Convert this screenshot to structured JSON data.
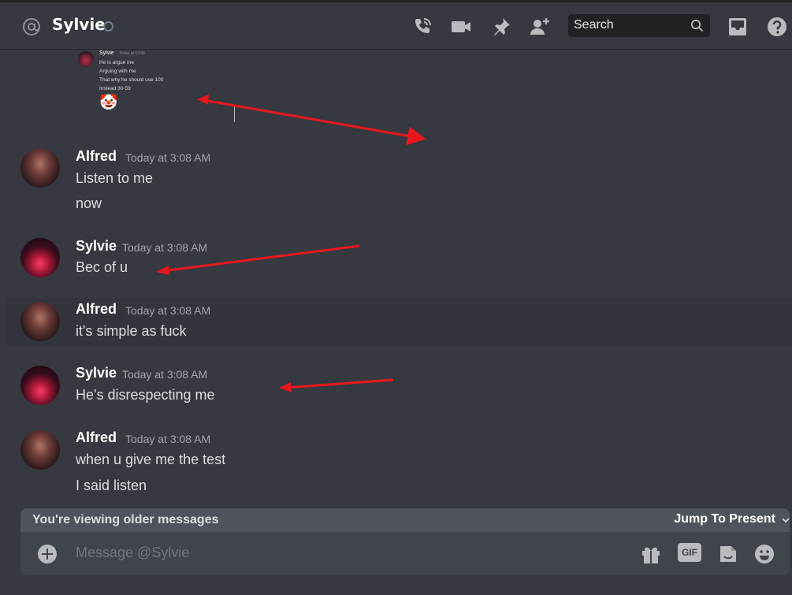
{
  "header": {
    "title": "Sylvie",
    "search_placeholder": "Search"
  },
  "embedded_screenshot": {
    "author": "Sylvie",
    "timestamp": "Today at 03:36",
    "lines": [
      "He is argue me",
      "Arguing with me",
      "That why he should use 100",
      "Instead 30-59"
    ],
    "emoji": "🤡"
  },
  "messages": [
    {
      "author": "Alfred",
      "timestamp": "Today at 3:08 AM",
      "lines": [
        "Listen to me",
        "now"
      ]
    },
    {
      "author": "Sylvie",
      "timestamp": "Today at 3:08 AM",
      "lines": [
        "Bec of u"
      ]
    },
    {
      "author": "Alfred",
      "timestamp": "Today at 3:08 AM",
      "lines": [
        "it's simple as fuck"
      ]
    },
    {
      "author": "Sylvie",
      "timestamp": "Today at 3:08 AM",
      "lines": [
        "He's disrespecting me"
      ]
    },
    {
      "author": "Alfred",
      "timestamp": "Today at 3:08 AM",
      "lines": [
        "when u give me the test",
        "I said listen"
      ]
    }
  ],
  "older_bar": {
    "text": "You're viewing older messages",
    "jump_label": "Jump To Present"
  },
  "composer": {
    "placeholder": "Message @Sylvie",
    "gif_label": "GIF"
  },
  "colors": {
    "background": "#36393f",
    "annotation_arrow": "#e8171e"
  },
  "icons": [
    "at-icon",
    "voice-call-icon",
    "video-call-icon",
    "pin-icon",
    "add-friend-icon",
    "search-icon",
    "inbox-icon",
    "help-icon",
    "gift-icon",
    "sticker-icon",
    "emoji-icon",
    "chevron-down-icon",
    "add-attachment-icon"
  ]
}
